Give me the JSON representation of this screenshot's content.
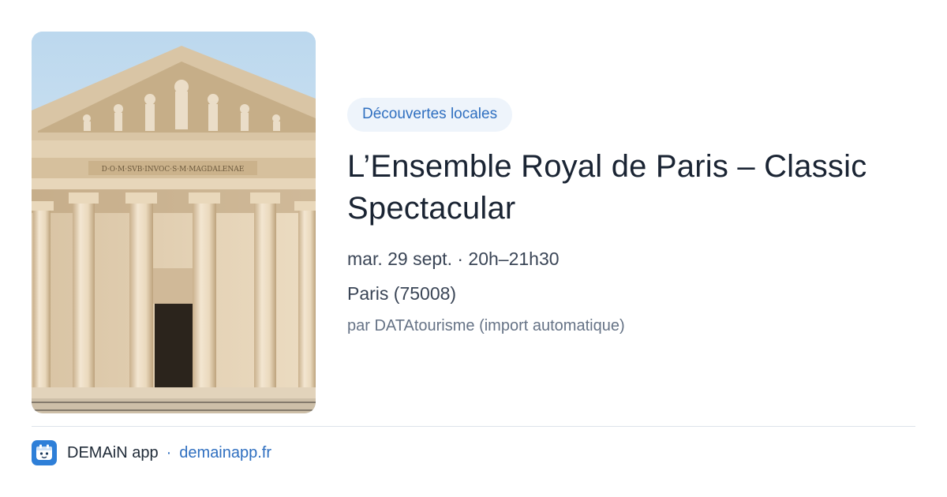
{
  "card": {
    "image_alt": "Église de la Madeleine",
    "pediment_inscription": "D·O·M·SVB·INVOC·S·M·MAGDALENAE",
    "category": "Découvertes locales",
    "title": "L’Ensemble Royal de Paris – Classic Spectacular",
    "datetime": "mar. 29 sept. · 20h–21h30",
    "location": "Paris (75008)",
    "source": "par DATAtourisme (import automatique)"
  },
  "footer": {
    "app_icon": "calendar-mascot-icon",
    "app_name": "DEMAiN app",
    "separator": "·",
    "domain": "demainapp.fr"
  },
  "colors": {
    "accent": "#2f6fc0",
    "badge_bg": "#eef4fb",
    "app_icon_bg": "#2e7fd8"
  }
}
